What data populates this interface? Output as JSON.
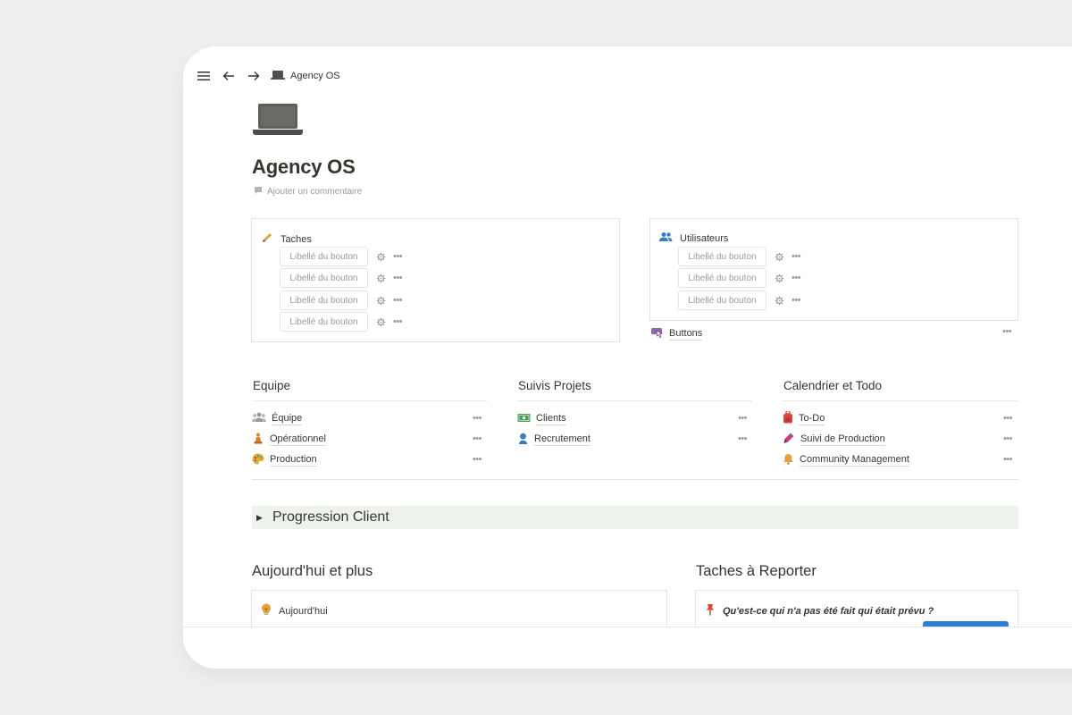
{
  "breadcrumb": {
    "title": "Agency OS"
  },
  "page": {
    "title": "Agency OS",
    "add_comment": "Ajouter un commentaire"
  },
  "taches": {
    "title": "Taches",
    "buttons": [
      "Libellé du bouton",
      "Libellé du bouton",
      "Libellé du bouton",
      "Libellé du bouton"
    ]
  },
  "utilisateurs": {
    "title": "Utilisateurs",
    "buttons": [
      "Libellé du bouton",
      "Libellé du bouton",
      "Libellé du bouton"
    ]
  },
  "buttons_link": "Buttons",
  "columns": [
    {
      "title": "Equipe",
      "items": [
        "Équipe",
        "Opérationnel",
        "Production"
      ]
    },
    {
      "title": "Suivis Projets",
      "items": [
        "Clients",
        "Recrutement"
      ]
    },
    {
      "title": "Calendrier et Todo",
      "items": [
        "To-Do",
        "Suivi de Production",
        "Community Management"
      ]
    }
  ],
  "toggle": {
    "label": "Progression Client"
  },
  "bottom": {
    "left_title": "Aujourd'hui et plus",
    "left_callout": "Aujourd'hui",
    "right_title": "Taches à Reporter",
    "right_callout": "Qu'est-ce qui n'a pas été fait qui était prévu ?"
  },
  "colors": {
    "accent_blue": "#2e7fd8",
    "toggle_bg": "#eef2ec",
    "text": "#37352f",
    "muted": "#9b9a97"
  }
}
